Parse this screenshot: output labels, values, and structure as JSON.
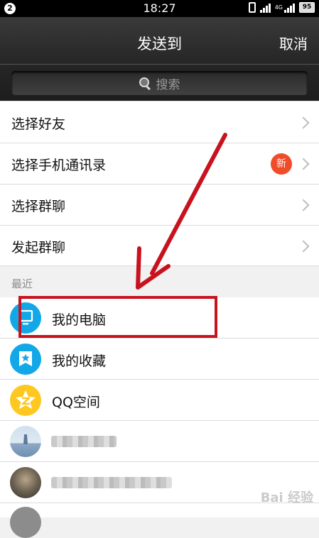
{
  "status_bar": {
    "notification_count": "2",
    "time": "18:27",
    "network": "4G",
    "battery": "95"
  },
  "header": {
    "title": "发送到",
    "cancel_label": "取消"
  },
  "search": {
    "placeholder": "搜索"
  },
  "menu": [
    {
      "label": "选择好友"
    },
    {
      "label": "选择手机通讯录",
      "badge": "新"
    },
    {
      "label": "选择群聊"
    },
    {
      "label": "发起群聊"
    }
  ],
  "recent": {
    "section_label": "最近",
    "items": [
      {
        "label": "我的电脑",
        "icon": "computer-icon"
      },
      {
        "label": "我的收藏",
        "icon": "favorites-icon"
      },
      {
        "label": "QQ空间",
        "icon": "qzone-icon"
      }
    ]
  },
  "watermark": "Bai 经验",
  "colors": {
    "badge": "#f04c2a",
    "annotation": "#c8121e",
    "computer": "#12a8e8",
    "qzone": "#ffc820"
  }
}
